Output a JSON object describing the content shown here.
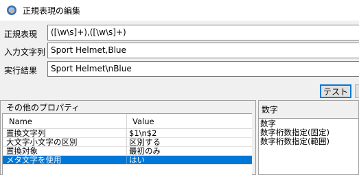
{
  "window": {
    "title": "正規表現の編集",
    "icon": "edit-document-icon"
  },
  "form": {
    "regex": {
      "label": "正規表現",
      "value": "([\\w\\s]+),([\\w\\s]+)"
    },
    "input": {
      "label": "入力文字列",
      "value": "Sport Helmet,Blue"
    },
    "result": {
      "label": "実行結果",
      "value": "Sport Helmet\\nBlue"
    }
  },
  "buttons": {
    "test_label": "テスト"
  },
  "properties": {
    "heading": "その他のプロパティ",
    "columns": [
      "Name",
      "Value"
    ],
    "rows": [
      {
        "name": "置換文字列",
        "value": "$1\\n$2"
      },
      {
        "name": "大文字小文字の区別",
        "value": "区別する"
      },
      {
        "name": "置換対象",
        "value": "最初のみ"
      },
      {
        "name": "メタ文字を使用",
        "value": "はい",
        "selected": true
      }
    ]
  },
  "side_list": {
    "header": "数字",
    "items": [
      "数字",
      "数字桁数指定(固定)",
      "数字桁数指定(範囲)"
    ]
  },
  "colors": {
    "selection": "#0078d7",
    "focus_border": "#0078d7",
    "window_bg": "#f0f0f0"
  }
}
